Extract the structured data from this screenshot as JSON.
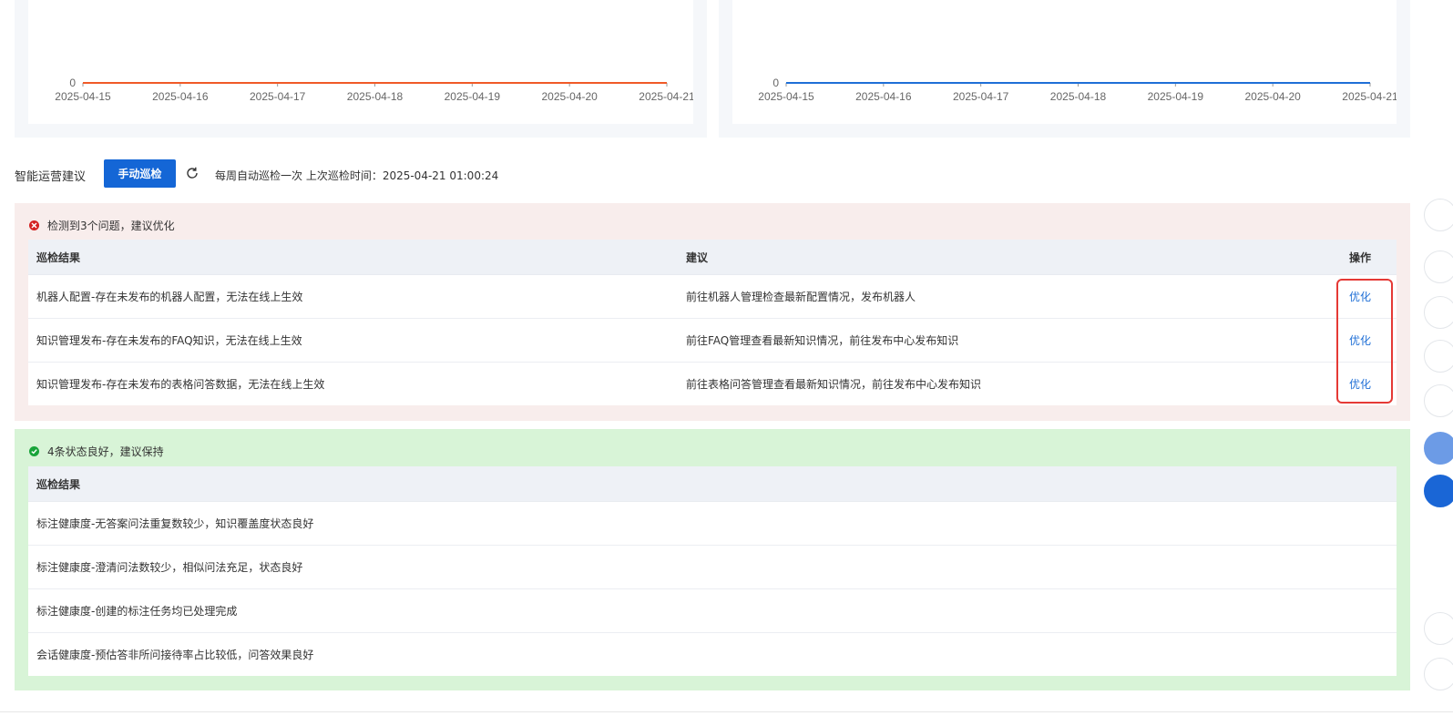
{
  "charts": [
    {
      "id": "left",
      "chart_data": {
        "type": "line",
        "x": [
          "2025-04-15",
          "2025-04-16",
          "2025-04-17",
          "2025-04-18",
          "2025-04-19",
          "2025-04-20",
          "2025-04-21"
        ],
        "values": [
          0,
          0,
          0,
          0,
          0,
          0,
          0
        ],
        "y_tick_label": "0",
        "color": "#f05a28"
      }
    },
    {
      "id": "right",
      "chart_data": {
        "type": "line",
        "x": [
          "2025-04-15",
          "2025-04-16",
          "2025-04-17",
          "2025-04-18",
          "2025-04-19",
          "2025-04-20",
          "2025-04-21"
        ],
        "values": [
          0,
          0,
          0,
          0,
          0,
          0,
          0
        ],
        "y_tick_label": "0",
        "color": "#1f6fd6"
      }
    }
  ],
  "ops": {
    "title": "智能运营建议",
    "manual_button": "手动巡检",
    "refresh_icon": "refresh-icon",
    "schedule": "每周自动巡检一次 上次巡检时间：2025-04-21 01:00:24"
  },
  "issues": {
    "header": "检测到3个问题，建议优化",
    "icon": "error-circle-icon",
    "columns": {
      "result": "巡检结果",
      "suggestion": "建议",
      "action": "操作"
    },
    "rows": [
      {
        "result": "机器人配置-存在未发布的机器人配置，无法在线上生效",
        "suggestion": "前往机器人管理检查最新配置情况，发布机器人",
        "action": "优化"
      },
      {
        "result": "知识管理发布-存在未发布的FAQ知识，无法在线上生效",
        "suggestion": "前往FAQ管理查看最新知识情况，前往发布中心发布知识",
        "action": "优化"
      },
      {
        "result": "知识管理发布-存在未发布的表格问答数据，无法在线上生效",
        "suggestion": "前往表格问答管理查看最新知识情况，前往发布中心发布知识",
        "action": "优化"
      }
    ]
  },
  "good": {
    "header": "4条状态良好，建议保持",
    "icon": "check-circle-icon",
    "columns": {
      "result": "巡检结果"
    },
    "rows": [
      {
        "result": "标注健康度-无答案问法重复数较少，知识覆盖度状态良好"
      },
      {
        "result": "标注健康度-澄清问法数较少，相似问法充足，状态良好"
      },
      {
        "result": "标注健康度-创建的标注任务均已处理完成"
      },
      {
        "result": "会话健康度-预估答非所问接待率占比较低，问答效果良好"
      }
    ]
  },
  "colors": {
    "primary": "#1466d6",
    "issue_bg": "#f8edec",
    "good_bg": "#d8f4d7",
    "error": "#d42323",
    "success": "#19a43a",
    "highlight": "#e53935"
  }
}
